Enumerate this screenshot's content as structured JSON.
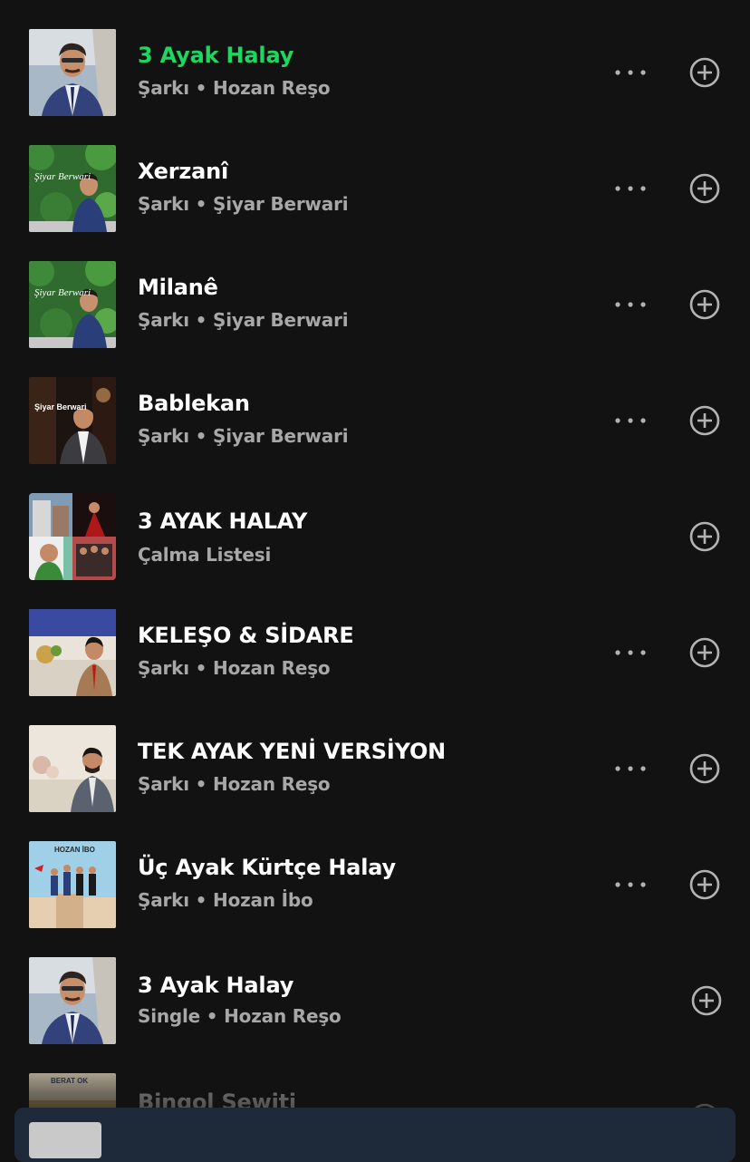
{
  "colors": {
    "background": "#121212",
    "active_title": "#1ed760",
    "subtitle": "#a7a7a7",
    "icon": "#b3b3b3",
    "miniplayer": "#1e2a3a"
  },
  "results": [
    {
      "title": "3 Ayak Halay",
      "subtitle": "Şarkı • Hozan Reşo",
      "active": true,
      "has_more": true,
      "art_caption": ""
    },
    {
      "title": "Xerzanî",
      "subtitle": "Şarkı • Şiyar Berwari",
      "active": false,
      "has_more": true,
      "art_caption": "Şiyar Berwari"
    },
    {
      "title": "Milanê",
      "subtitle": "Şarkı • Şiyar Berwari",
      "active": false,
      "has_more": true,
      "art_caption": "Şiyar Berwari"
    },
    {
      "title": "Bablekan",
      "subtitle": "Şarkı • Şiyar Berwari",
      "active": false,
      "has_more": true,
      "art_caption": "Şiyar Berwari"
    },
    {
      "title": "3 AYAK HALAY",
      "subtitle": "Çalma Listesi",
      "active": false,
      "has_more": false,
      "art_caption": ""
    },
    {
      "title": "KELEŞO & SİDARE",
      "subtitle": "Şarkı • Hozan Reşo",
      "active": false,
      "has_more": true,
      "art_caption": ""
    },
    {
      "title": "TEK AYAK YENİ VERSİYON",
      "subtitle": "Şarkı • Hozan Reşo",
      "active": false,
      "has_more": true,
      "art_caption": ""
    },
    {
      "title": "Üç Ayak Kürtçe Halay",
      "subtitle": "Şarkı • Hozan İbo",
      "active": false,
      "has_more": true,
      "art_caption": "HOZAN İBO"
    },
    {
      "title": "3 Ayak Halay",
      "subtitle": "Single • Hozan Reşo",
      "active": false,
      "has_more": false,
      "art_caption": ""
    },
    {
      "title": "Bingol Sewiti",
      "subtitle": "",
      "active": false,
      "has_more": false,
      "art_caption": "BERAT OK"
    }
  ],
  "icons": {
    "more": "more-options-icon",
    "add": "add-circle-icon"
  }
}
